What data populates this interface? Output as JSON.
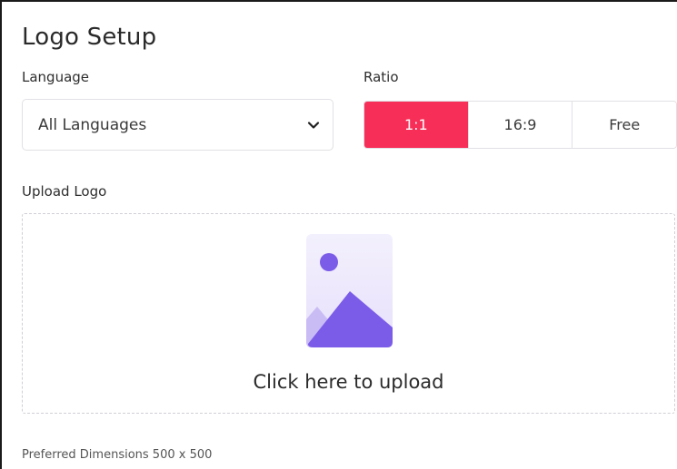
{
  "title": "Logo Setup",
  "language": {
    "label": "Language",
    "selected": "All Languages",
    "icon": "chevron-down-icon"
  },
  "ratio": {
    "label": "Ratio",
    "options": [
      "1:1",
      "16:9",
      "Free"
    ],
    "selected": "1:1",
    "active_color": "#f72e57"
  },
  "upload": {
    "label": "Upload Logo",
    "prompt": "Click here to upload",
    "icon": "image-placeholder-icon",
    "accent_color": "#7b5ce8"
  },
  "hint": "Preferred Dimensions 500 x 500"
}
